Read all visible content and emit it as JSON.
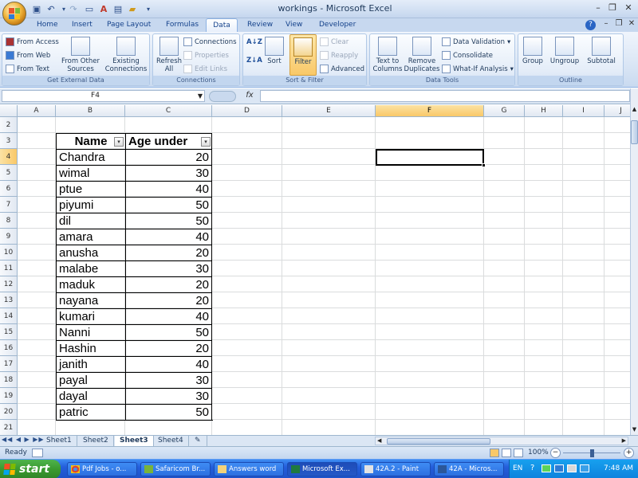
{
  "window": {
    "title": "workings - Microsoft Excel"
  },
  "ribbon_tabs": [
    "Home",
    "Insert",
    "Page Layout",
    "Formulas",
    "Data",
    "Review",
    "View",
    "Developer"
  ],
  "active_tab": "Data",
  "ribbon": {
    "get_external": {
      "label": "Get External Data",
      "from_access": "From Access",
      "from_web": "From Web",
      "from_text": "From Text",
      "from_other": "From Other\nSources",
      "existing": "Existing\nConnections"
    },
    "connections": {
      "label": "Connections",
      "refresh": "Refresh\nAll",
      "connections": "Connections",
      "properties": "Properties",
      "edit_links": "Edit Links"
    },
    "sort_filter": {
      "label": "Sort & Filter",
      "sort": "Sort",
      "filter": "Filter",
      "clear": "Clear",
      "reapply": "Reapply",
      "advanced": "Advanced",
      "az": "A\nZ",
      "za": "Z\nA"
    },
    "data_tools": {
      "label": "Data Tools",
      "text_to_columns": "Text to\nColumns",
      "remove_duplicates": "Remove\nDuplicates",
      "data_validation": "Data Validation",
      "consolidate": "Consolidate",
      "what_if": "What-If Analysis"
    },
    "outline": {
      "label": "Outline",
      "group": "Group",
      "ungroup": "Ungroup",
      "subtotal": "Subtotal"
    }
  },
  "formula_bar": {
    "name_box": "F4",
    "fx": "fx",
    "value": ""
  },
  "columns": [
    "A",
    "B",
    "C",
    "D",
    "E",
    "F",
    "G",
    "H",
    "I",
    "J"
  ],
  "rows": [
    "2",
    "3",
    "4",
    "5",
    "6",
    "7",
    "8",
    "9",
    "10",
    "11",
    "12",
    "13",
    "14",
    "15",
    "16",
    "17",
    "18",
    "19",
    "20",
    "21"
  ],
  "table": {
    "headers": [
      "Name",
      "Age under"
    ],
    "data": [
      [
        "Chandra",
        "20"
      ],
      [
        "wimal",
        "30"
      ],
      [
        "ptue",
        "40"
      ],
      [
        "piyumi",
        "50"
      ],
      [
        "dil",
        "50"
      ],
      [
        "amara",
        "40"
      ],
      [
        "anusha",
        "20"
      ],
      [
        "malabe",
        "30"
      ],
      [
        "maduk",
        "20"
      ],
      [
        "nayana",
        "20"
      ],
      [
        "kumari",
        "40"
      ],
      [
        "Nanni",
        "50"
      ],
      [
        "Hashin",
        "20"
      ],
      [
        "janith",
        "40"
      ],
      [
        "payal",
        "30"
      ],
      [
        "dayal",
        "30"
      ],
      [
        "patric",
        "50"
      ]
    ]
  },
  "sheet_tabs": [
    "Sheet1",
    "Sheet2",
    "Sheet3",
    "Sheet4"
  ],
  "active_sheet": "Sheet3",
  "status": {
    "ready": "Ready",
    "zoom": "100%"
  },
  "taskbar": {
    "start": "start",
    "items": [
      "Pdf Jobs - o...",
      "Safaricom Br...",
      "Answers word",
      "Microsoft Ex...",
      "42A.2 - Paint",
      "42A - Micros..."
    ],
    "active_item": 3,
    "lang": "EN",
    "clock": "7:48 AM"
  },
  "colors": {
    "accent": "#f9c868",
    "taskbar": "#245edb",
    "start": "#3a9a2f"
  }
}
